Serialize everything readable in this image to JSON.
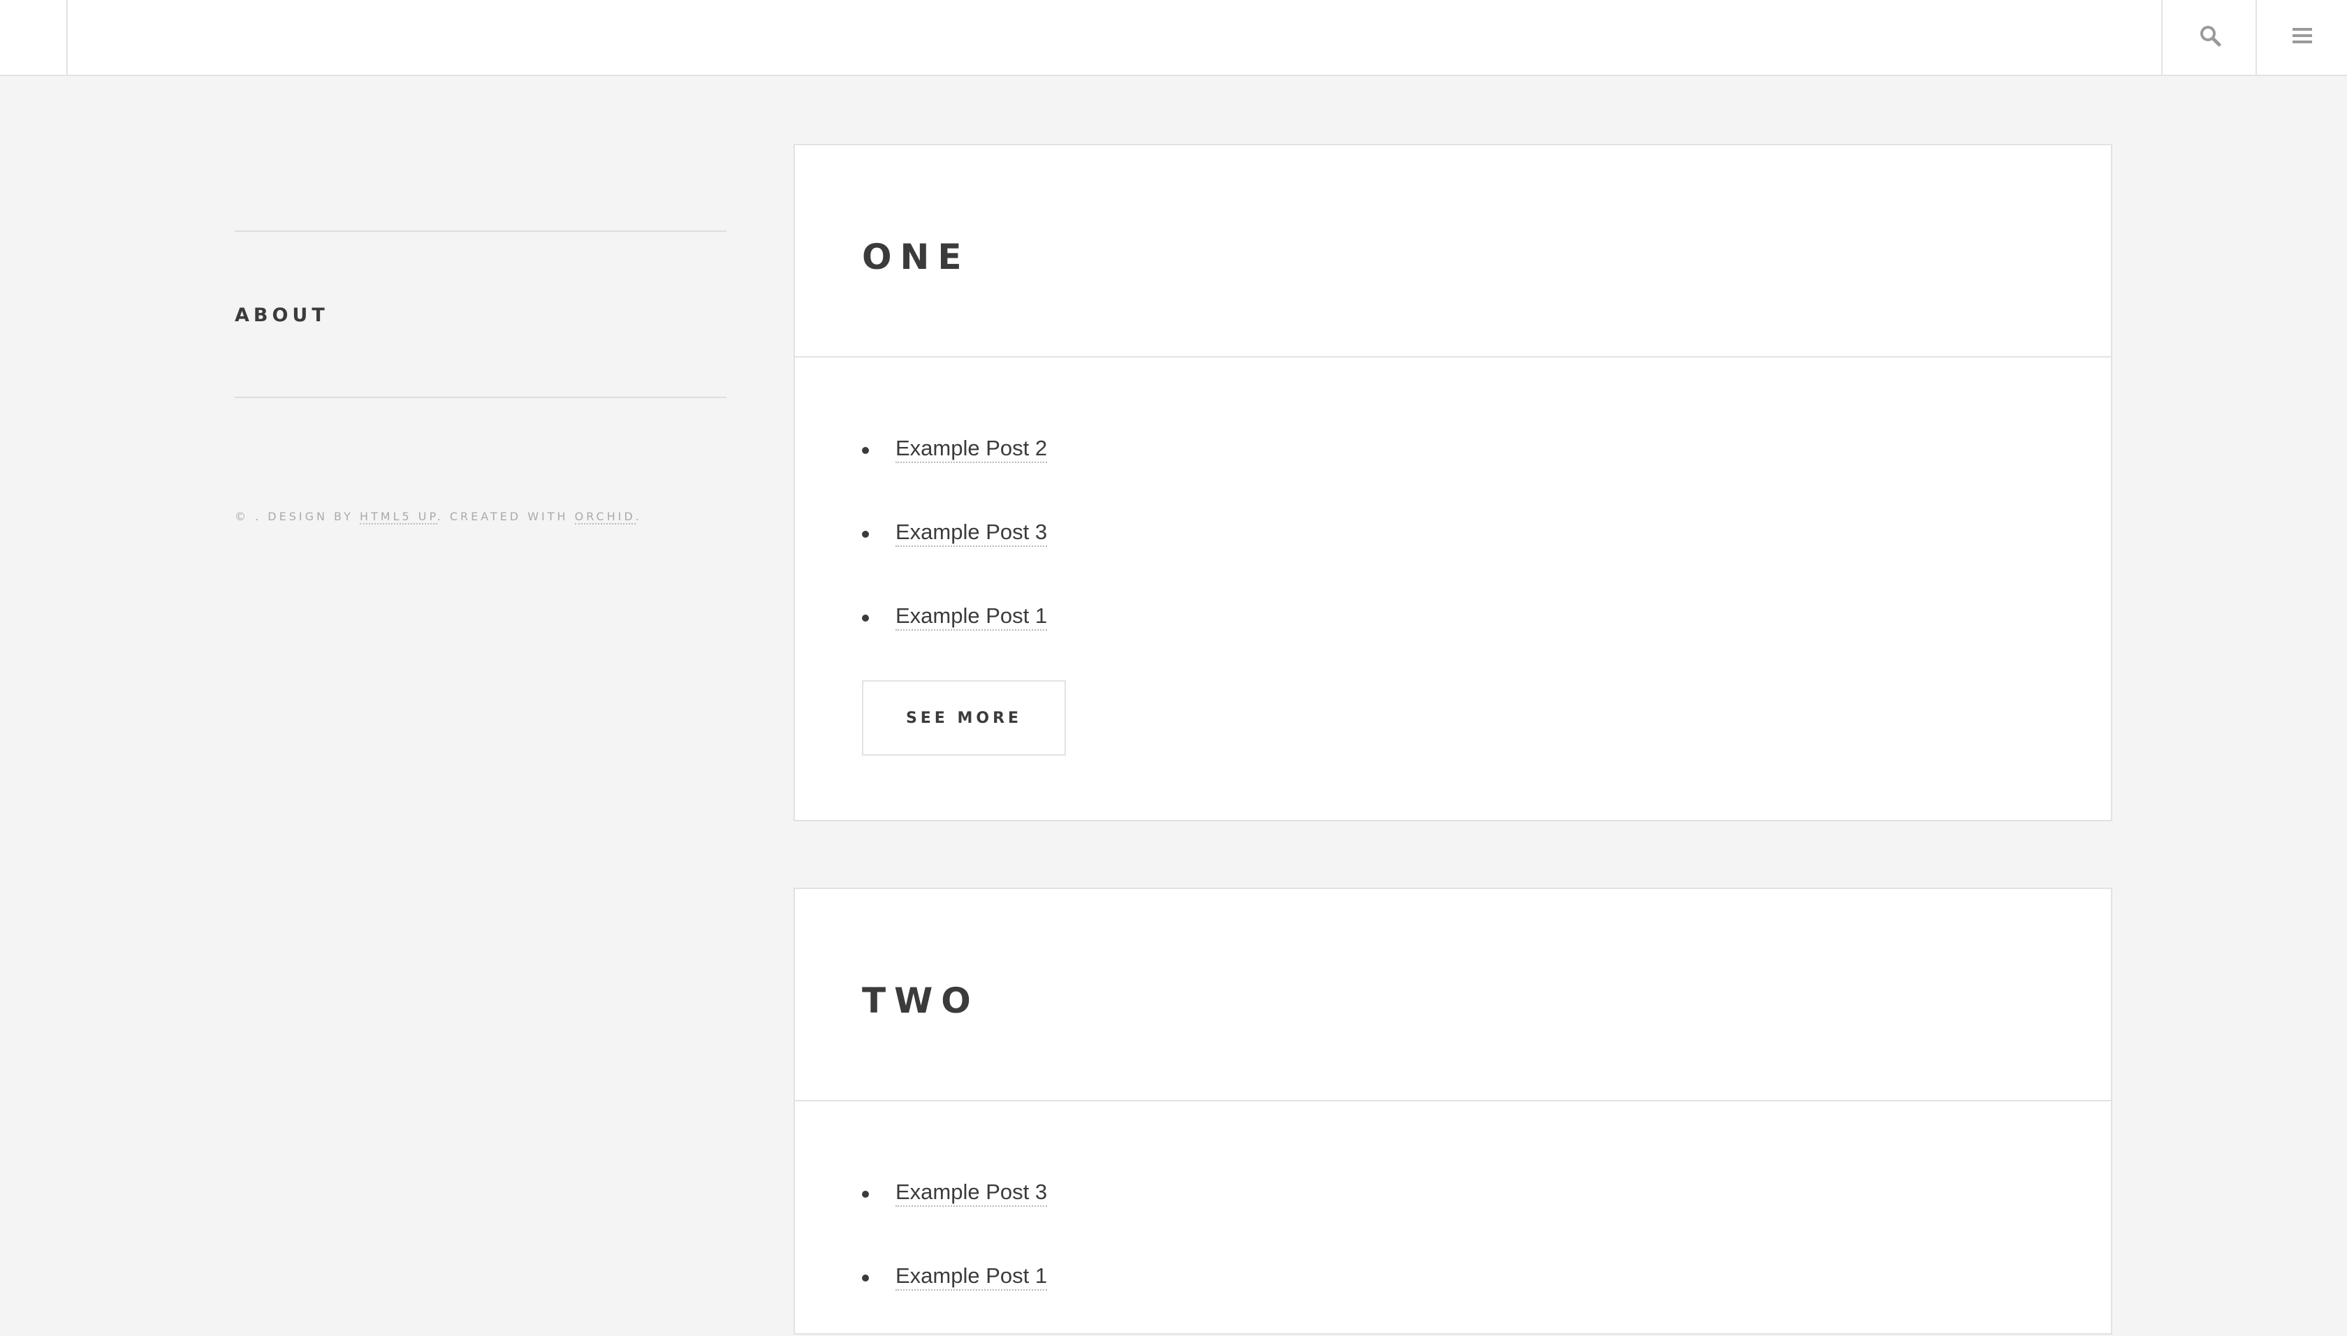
{
  "header": {
    "search_icon": "search-icon",
    "menu_icon": "menu-icon"
  },
  "sidebar": {
    "about_title": "ABOUT",
    "copyright": {
      "prefix": "© . DESIGN BY ",
      "design_link": "HTML5 UP",
      "middle": ". CREATED WITH ",
      "created_link": "ORCHID",
      "suffix": "."
    }
  },
  "sections": [
    {
      "title": "ONE",
      "posts": [
        "Example Post 2",
        "Example Post 3",
        "Example Post 1"
      ],
      "see_more_label": "SEE MORE"
    },
    {
      "title": "TWO",
      "posts": [
        "Example Post 3",
        "Example Post 1"
      ]
    }
  ],
  "colors": {
    "background": "#f4f4f4",
    "card": "#ffffff",
    "border": "#e2e2e2",
    "text": "#3c3b3b",
    "muted": "#aaaaaa"
  }
}
